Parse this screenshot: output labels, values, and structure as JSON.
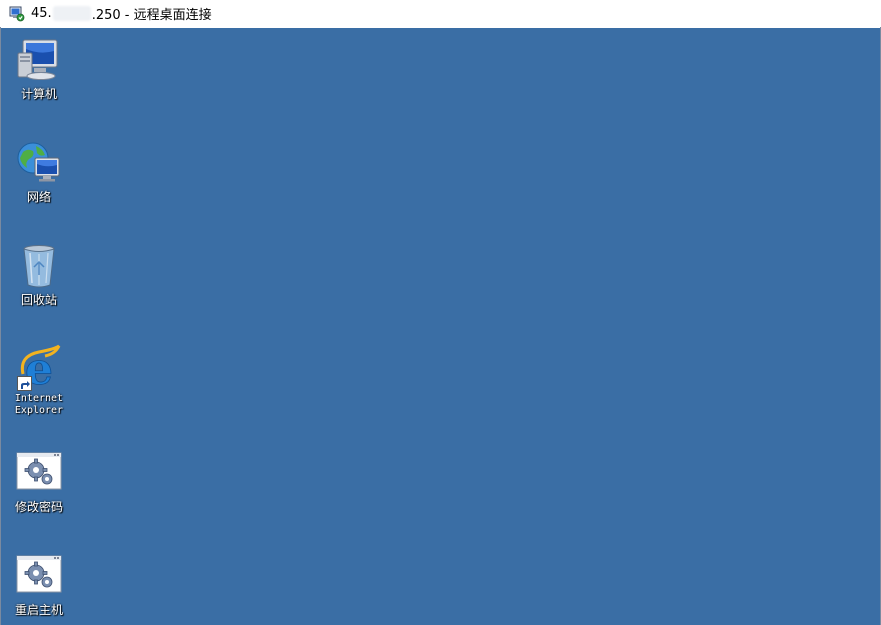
{
  "window": {
    "title_prefix": "45.",
    "title_suffix": ".250 - 远程桌面连接"
  },
  "desktop": {
    "background": "#3a6ea5",
    "icons": [
      {
        "label": "计算机",
        "icon": "computer-icon"
      },
      {
        "label": "网络",
        "icon": "network-icon"
      },
      {
        "label": "回收站",
        "icon": "recycle-bin-icon"
      },
      {
        "label_line1": "Internet",
        "label_line2": "Explorer",
        "icon": "internet-explorer-icon"
      },
      {
        "label": "修改密码",
        "icon": "settings-gear-icon"
      },
      {
        "label": "重启主机",
        "icon": "settings-gear-icon"
      }
    ]
  }
}
